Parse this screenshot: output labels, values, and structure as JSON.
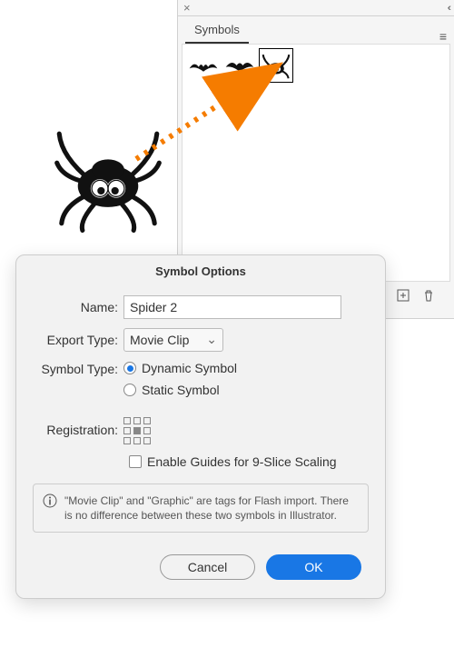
{
  "symbols_panel": {
    "tab_label": "Symbols",
    "close_glyph": "×",
    "collapse_glyph": "‹‹",
    "menu_glyph": "≡",
    "new_glyph": "⊞",
    "trash_glyph": "🗑",
    "thumbs": [
      {
        "name": "bat-1-symbol",
        "plus": "+"
      },
      {
        "name": "bat-2-symbol",
        "plus": "+"
      },
      {
        "name": "spider-symbol-selected",
        "plus": ""
      }
    ]
  },
  "dialog": {
    "title": "Symbol Options",
    "name_label": "Name:",
    "name_value": "Spider 2",
    "export_label": "Export Type:",
    "export_value": "Movie Clip",
    "symbol_type_label": "Symbol Type:",
    "radio_dynamic": "Dynamic Symbol",
    "radio_static": "Static Symbol",
    "registration_label": "Registration:",
    "checkbox_label": "Enable Guides for 9-Slice Scaling",
    "info_text": "\"Movie Clip\" and \"Graphic\" are tags for Flash import. There is no difference between these two symbols in Illustrator.",
    "info_glyph": "ⓘ",
    "cancel_label": "Cancel",
    "ok_label": "OK"
  }
}
